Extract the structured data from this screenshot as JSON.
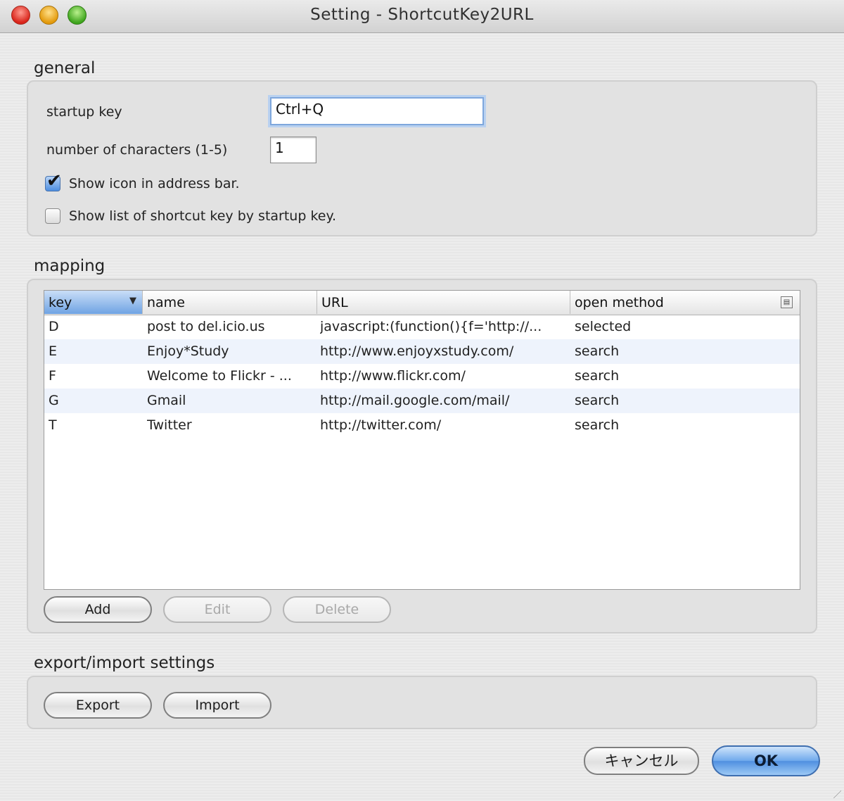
{
  "window": {
    "title": "Setting - ShortcutKey2URL"
  },
  "general": {
    "label": "general",
    "startup_key_label": "startup key",
    "startup_key_value": "Ctrl+Q",
    "num_chars_label": "number of characters (1-5)",
    "num_chars_value": "1",
    "show_icon_label": "Show icon in address bar.",
    "show_icon_checked": true,
    "show_list_label": "Show list of shortcut key by startup key.",
    "show_list_checked": false
  },
  "mapping": {
    "label": "mapping",
    "columns": [
      "key",
      "name",
      "URL",
      "open method"
    ],
    "sorted_column": "key",
    "rows": [
      {
        "key": "D",
        "name": "post to del.icio.us",
        "url": "javascript:(function(){f='http://...",
        "method": "selected"
      },
      {
        "key": "E",
        "name": "Enjoy*Study",
        "url": "http://www.enjoyxstudy.com/",
        "method": "search"
      },
      {
        "key": "F",
        "name": "Welcome to Flickr - ...",
        "url": "http://www.flickr.com/",
        "method": "search"
      },
      {
        "key": "G",
        "name": "Gmail",
        "url": "http://mail.google.com/mail/",
        "method": "search"
      },
      {
        "key": "T",
        "name": "Twitter",
        "url": "http://twitter.com/",
        "method": "search"
      }
    ],
    "add_label": "Add",
    "edit_label": "Edit",
    "delete_label": "Delete"
  },
  "export_import": {
    "label": "export/import settings",
    "export_label": "Export",
    "import_label": "Import"
  },
  "footer": {
    "cancel_label": "キャンセル",
    "ok_label": "OK"
  },
  "colors": {
    "accent": "#4f8fe0",
    "row_alt": "#eef3fc"
  }
}
